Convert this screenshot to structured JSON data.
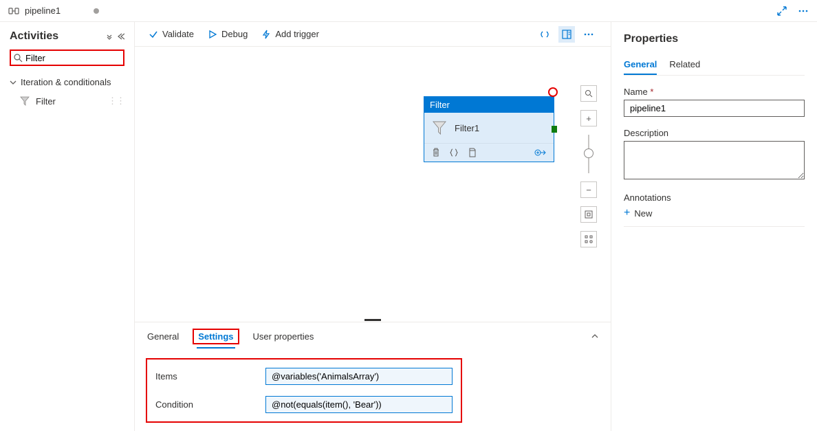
{
  "topbar": {
    "tab_name": "pipeline1"
  },
  "sidebar": {
    "title": "Activities",
    "search_value": "Filter",
    "group_label": "Iteration & conditionals",
    "activity_label": "Filter"
  },
  "toolbar": {
    "validate": "Validate",
    "debug": "Debug",
    "add_trigger": "Add trigger"
  },
  "node": {
    "header": "Filter",
    "name": "Filter1"
  },
  "bottom": {
    "tabs": {
      "general": "General",
      "settings": "Settings",
      "user_props": "User properties"
    },
    "items_label": "Items",
    "items_value": "@variables('AnimalsArray')",
    "condition_label": "Condition",
    "condition_value": "@not(equals(item(), 'Bear'))"
  },
  "properties": {
    "title": "Properties",
    "tabs": {
      "general": "General",
      "related": "Related"
    },
    "name_label": "Name",
    "name_value": "pipeline1",
    "description_label": "Description",
    "annotations_label": "Annotations",
    "new_label": "New"
  }
}
